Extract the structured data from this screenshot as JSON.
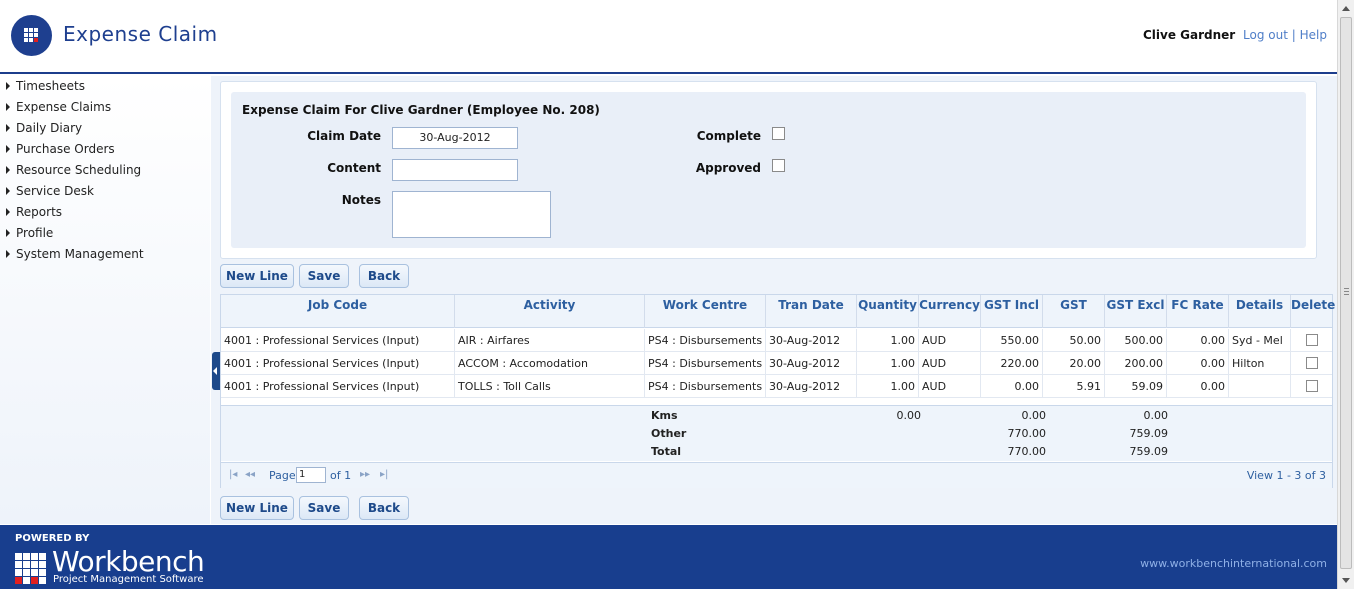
{
  "header": {
    "title": "Expense Claim",
    "user_name": "Clive Gardner",
    "logout_label": "Log out",
    "separator": "|",
    "help_label": "Help"
  },
  "sidebar": {
    "items": [
      {
        "label": "Timesheets"
      },
      {
        "label": "Expense Claims"
      },
      {
        "label": "Daily Diary"
      },
      {
        "label": "Purchase Orders"
      },
      {
        "label": "Resource Scheduling"
      },
      {
        "label": "Service Desk"
      },
      {
        "label": "Reports"
      },
      {
        "label": "Profile"
      },
      {
        "label": "System Management"
      }
    ]
  },
  "form": {
    "heading": "Expense Claim For Clive Gardner (Employee No. 208)",
    "claim_date_label": "Claim Date",
    "claim_date_value": "30-Aug-2012",
    "content_label": "Content",
    "content_value": "",
    "notes_label": "Notes",
    "notes_value": "",
    "complete_label": "Complete",
    "complete_checked": false,
    "approved_label": "Approved",
    "approved_checked": false
  },
  "buttons": {
    "new_line": "New Line",
    "save": "Save",
    "back": "Back"
  },
  "grid": {
    "columns": [
      "Job Code",
      "Activity",
      "Work Centre",
      "Tran Date",
      "Quantity",
      "Currency",
      "GST Incl",
      "GST",
      "GST Excl",
      "FC Rate",
      "Details",
      "Delete"
    ],
    "rows": [
      {
        "job_code": "4001 : Professional Services (Input)",
        "activity": "AIR : Airfares",
        "work_centre": "PS4 : Disbursements",
        "tran_date": "30-Aug-2012",
        "quantity": "1.00",
        "currency": "AUD",
        "gst_incl": "550.00",
        "gst": "50.00",
        "gst_excl": "500.00",
        "fc_rate": "0.00",
        "details": "Syd - Mel"
      },
      {
        "job_code": "4001 : Professional Services (Input)",
        "activity": "ACCOM : Accomodation",
        "work_centre": "PS4 : Disbursements",
        "tran_date": "30-Aug-2012",
        "quantity": "1.00",
        "currency": "AUD",
        "gst_incl": "220.00",
        "gst": "20.00",
        "gst_excl": "200.00",
        "fc_rate": "0.00",
        "details": "Hilton"
      },
      {
        "job_code": "4001 : Professional Services (Input)",
        "activity": "TOLLS : Toll Calls",
        "work_centre": "PS4 : Disbursements",
        "tran_date": "30-Aug-2012",
        "quantity": "1.00",
        "currency": "AUD",
        "gst_incl": "0.00",
        "gst": "5.91",
        "gst_excl": "59.09",
        "fc_rate": "0.00",
        "details": ""
      }
    ],
    "summary": {
      "kms_label": "Kms",
      "kms_qty": "0.00",
      "kms_incl": "0.00",
      "kms_excl": "0.00",
      "other_label": "Other",
      "other_incl": "770.00",
      "other_excl": "759.09",
      "total_label": "Total",
      "total_incl": "770.00",
      "total_excl": "759.09"
    },
    "pager": {
      "first": "|◂",
      "prev": "◂◂",
      "page_label": "Page",
      "page_value": "1",
      "of_label": "of 1",
      "next": "▸▸",
      "last": "▸|",
      "view_text": "View 1 - 3 of 3"
    }
  },
  "footer": {
    "powered_by": "POWERED BY",
    "brand": "Workbench",
    "tagline": "Project Management Software",
    "url": "www.workbenchinternational.com"
  },
  "colors": {
    "brand_blue": "#1e3f8f",
    "footer_blue": "#183e8e",
    "link_blue": "#4f7ec8",
    "accent_red": "#e02020"
  }
}
